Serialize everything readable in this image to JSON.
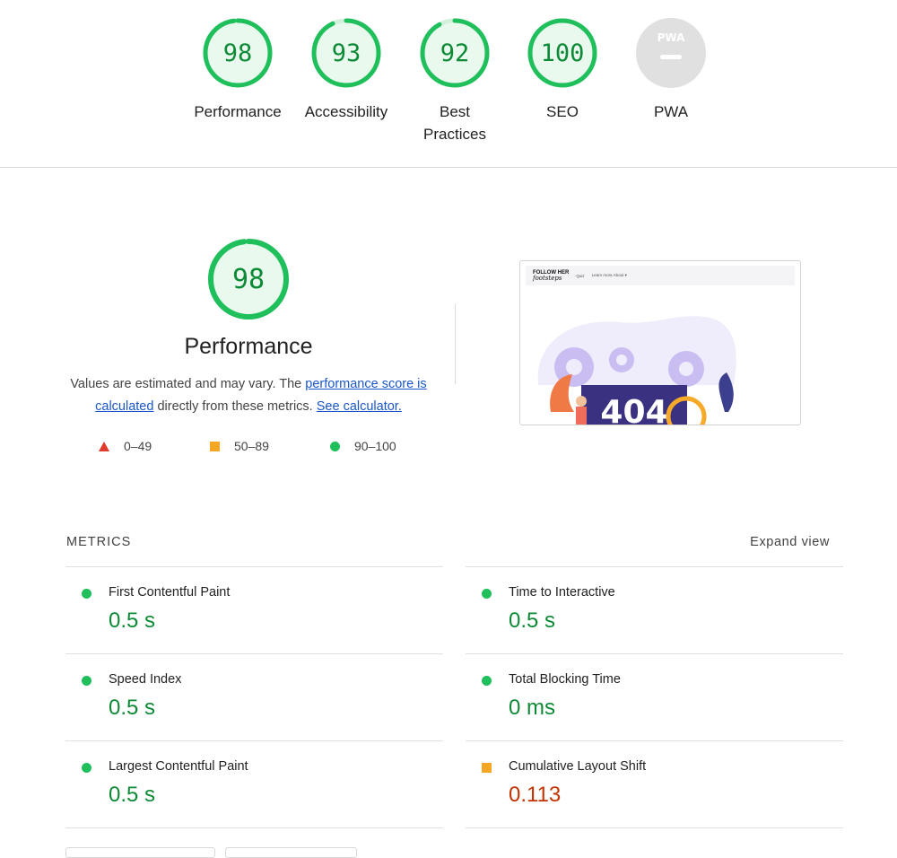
{
  "gauges": [
    {
      "label": "Performance",
      "score": "98",
      "status": "pass"
    },
    {
      "label": "Accessibility",
      "score": "93",
      "status": "pass"
    },
    {
      "label": "Best Practices",
      "score": "92",
      "status": "pass"
    },
    {
      "label": "SEO",
      "score": "100",
      "status": "pass"
    },
    {
      "label": "PWA",
      "score": "",
      "status": "na"
    }
  ],
  "pwa_badge": "PWA",
  "summary": {
    "score": "98",
    "title": "Performance",
    "desc_text1": "Values are estimated and may vary. The ",
    "desc_link1": "performance score is calculated",
    "desc_text2": " directly from these metrics. ",
    "desc_link2": "See calculator.",
    "scale": {
      "fail": "0–49",
      "average": "50–89",
      "pass": "90–100"
    }
  },
  "screenshot": {
    "logo_line1": "FOLLOW HER",
    "logo_line2": "footsteps",
    "nav_link1": "Quiz",
    "nav_link2": "Learn more About ▾",
    "art_text": "404"
  },
  "metrics": {
    "heading": "METRICS",
    "expand_label": "Expand view",
    "left": [
      {
        "title": "First Contentful Paint",
        "value": "0.5 s",
        "status": "pass"
      },
      {
        "title": "Speed Index",
        "value": "0.5 s",
        "status": "pass"
      },
      {
        "title": "Largest Contentful Paint",
        "value": "0.5 s",
        "status": "pass"
      }
    ],
    "right": [
      {
        "title": "Time to Interactive",
        "value": "0.5 s",
        "status": "pass"
      },
      {
        "title": "Total Blocking Time",
        "value": "0 ms",
        "status": "pass"
      },
      {
        "title": "Cumulative Layout Shift",
        "value": "0.113",
        "status": "average"
      }
    ]
  },
  "colors": {
    "pass": "#0c8a35",
    "pass_ring": "#1fbf5c",
    "pass_fill": "#e9f9ee",
    "average": "#f5a623",
    "fail": "#e03a2d",
    "na": "#e0e0e0",
    "link": "#1a56c8"
  }
}
